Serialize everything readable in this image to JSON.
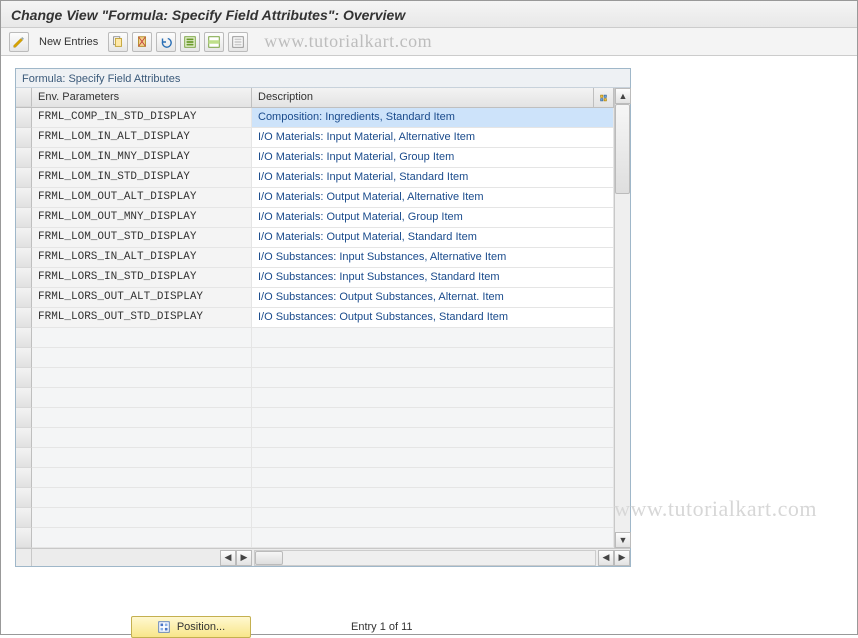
{
  "title": "Change View \"Formula: Specify Field Attributes\": Overview",
  "toolbar": {
    "new_entries": "New Entries"
  },
  "watermark": "www.tutorialkart.com",
  "panel": {
    "title": "Formula: Specify Field Attributes",
    "col_env": "Env. Parameters",
    "col_desc": "Description"
  },
  "rows": [
    {
      "env": "FRML_COMP_IN_STD_DISPLAY",
      "desc": "Composition: Ingredients, Standard Item",
      "selected": true
    },
    {
      "env": "FRML_LOM_IN_ALT_DISPLAY",
      "desc": "I/O Materials: Input Material, Alternative Item"
    },
    {
      "env": "FRML_LOM_IN_MNY_DISPLAY",
      "desc": "I/O Materials: Input Material, Group Item"
    },
    {
      "env": "FRML_LOM_IN_STD_DISPLAY",
      "desc": "I/O Materials: Input Material, Standard Item"
    },
    {
      "env": "FRML_LOM_OUT_ALT_DISPLAY",
      "desc": "I/O Materials: Output Material, Alternative Item"
    },
    {
      "env": "FRML_LOM_OUT_MNY_DISPLAY",
      "desc": "I/O Materials: Output Material, Group Item"
    },
    {
      "env": "FRML_LOM_OUT_STD_DISPLAY",
      "desc": "I/O Materials: Output Material, Standard Item"
    },
    {
      "env": "FRML_LORS_IN_ALT_DISPLAY",
      "desc": "I/O Substances: Input Substances, Alternative Item"
    },
    {
      "env": "FRML_LORS_IN_STD_DISPLAY",
      "desc": "I/O Substances: Input Substances, Standard Item"
    },
    {
      "env": "FRML_LORS_OUT_ALT_DISPLAY",
      "desc": "I/O Substances: Output Substances, Alternat. Item"
    },
    {
      "env": "FRML_LORS_OUT_STD_DISPLAY",
      "desc": "I/O Substances: Output Substances, Standard Item"
    }
  ],
  "empty_rows": 11,
  "footer": {
    "position_label": "Position...",
    "entry_text": "Entry 1 of 11"
  }
}
